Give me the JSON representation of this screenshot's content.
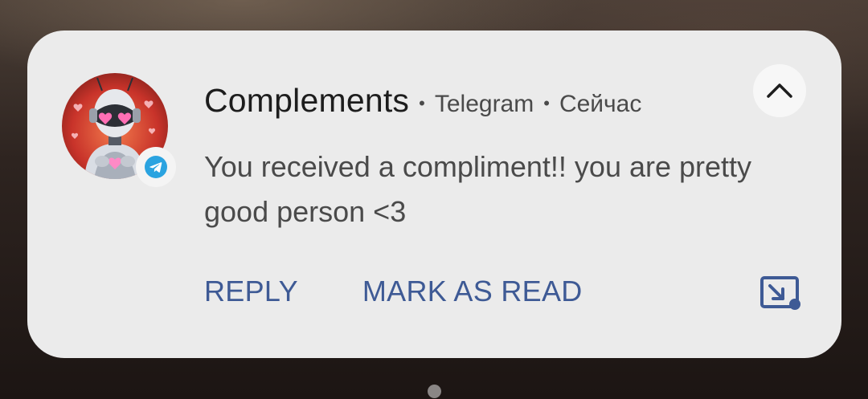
{
  "notification": {
    "title": "Complements",
    "app_name": "Telegram",
    "time": "Сейчас",
    "separator": "•",
    "message": "You received a compliment!! you are pretty good person <3",
    "actions": {
      "reply_label": "REPLY",
      "mark_read_label": "MARK AS READ"
    },
    "icons": {
      "avatar": "robot-avatar",
      "app_badge": "telegram-icon",
      "collapse": "chevron-up-icon",
      "pip": "picture-in-picture-icon"
    }
  },
  "colors": {
    "card_bg": "#ebebeb",
    "action": "#3e5a95",
    "telegram": "#2aa3e0"
  }
}
